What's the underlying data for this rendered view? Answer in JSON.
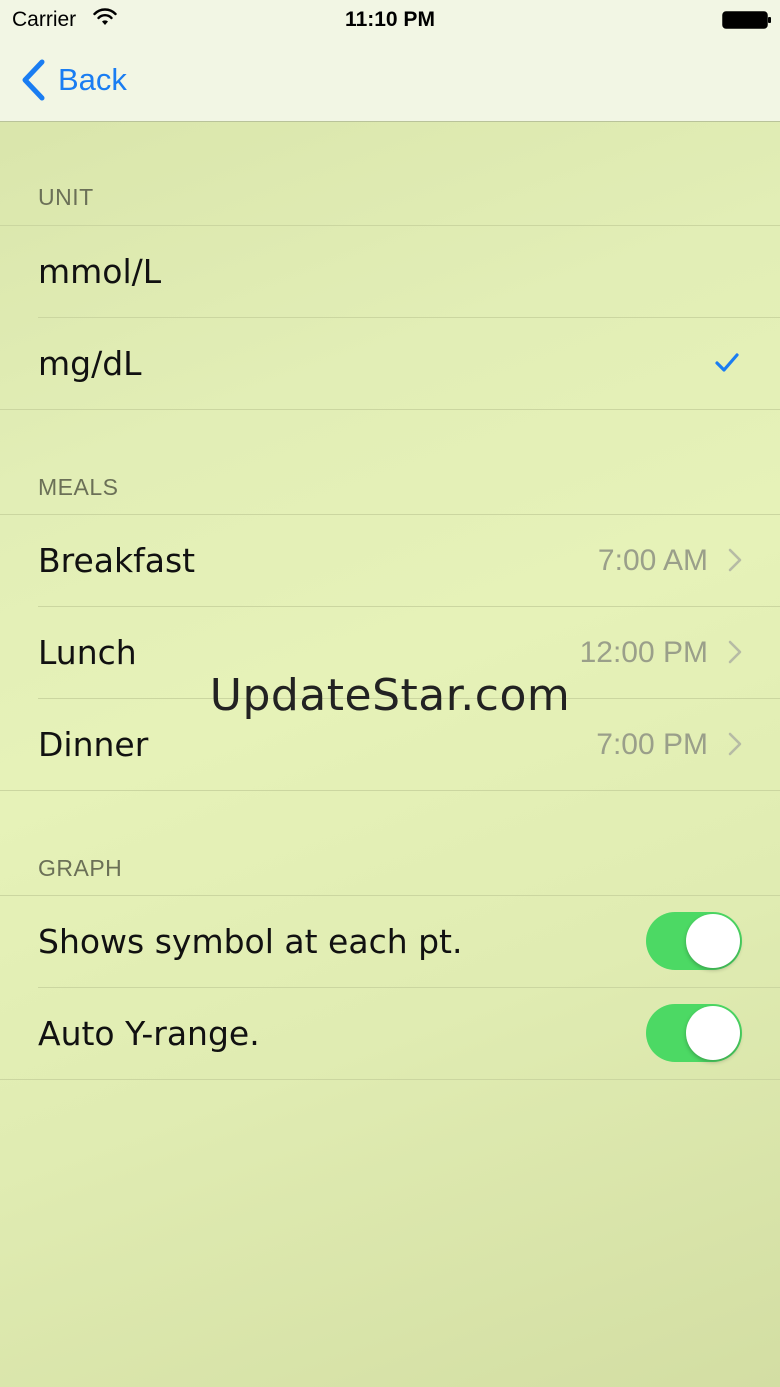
{
  "status_bar": {
    "carrier": "Carrier",
    "time": "11:10 PM"
  },
  "nav": {
    "back_label": "Back"
  },
  "unit_section": {
    "header": "UNIT",
    "options": [
      {
        "label": "mmol/L",
        "selected": false
      },
      {
        "label": "mg/dL",
        "selected": true
      }
    ]
  },
  "meals_section": {
    "header": "MEALS",
    "items": [
      {
        "label": "Breakfast",
        "value": "7:00 AM"
      },
      {
        "label": "Lunch",
        "value": "12:00 PM"
      },
      {
        "label": "Dinner",
        "value": "7:00 PM"
      }
    ]
  },
  "graph_section": {
    "header": "GRAPH",
    "toggles": [
      {
        "label": "Shows symbol at each pt.",
        "on": true
      },
      {
        "label": "Auto Y-range.",
        "on": true
      }
    ]
  },
  "watermark": "UpdateStar.com",
  "colors": {
    "accent": "#1a7df2",
    "toggle_on": "#4cd964"
  },
  "icons": [
    "wifi-icon",
    "battery-icon",
    "back-chevron-icon",
    "checkmark-icon",
    "chevron-right-icon"
  ]
}
